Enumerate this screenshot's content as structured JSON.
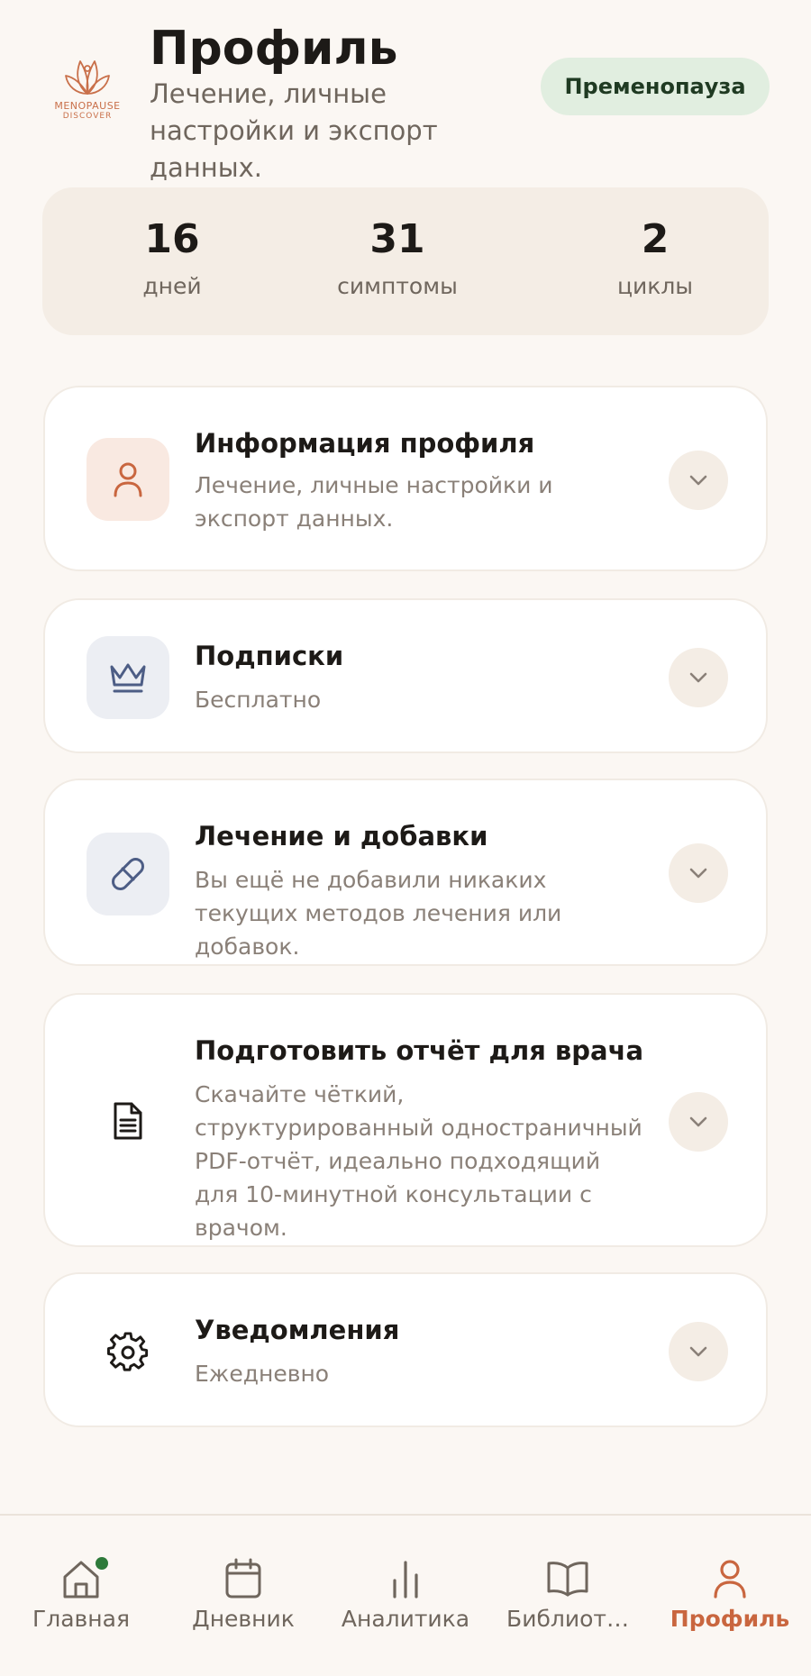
{
  "header": {
    "logo_brand": "MENOPAUSE",
    "logo_sub": "DISCOVER",
    "title": "Профиль",
    "subtitle": "Лечение, личные настройки и экспорт данных.",
    "stage_badge": "Пременопауза"
  },
  "stats": [
    {
      "value": "16",
      "label": "дней"
    },
    {
      "value": "31",
      "label": "симптомы"
    },
    {
      "value": "2",
      "label": "циклы"
    }
  ],
  "cards": [
    {
      "title": "Информация профиля",
      "subtitle": "Лечение, личные настройки и экспорт данных.",
      "icon": "person-icon"
    },
    {
      "title": "Подписки",
      "subtitle": "Бесплатно",
      "icon": "crown-icon"
    },
    {
      "title": "Лечение и добавки",
      "subtitle": "Вы ещё не добавили никаких текущих методов лечения или добавок.",
      "icon": "pill-icon"
    },
    {
      "title": "Подготовить отчёт для врача",
      "subtitle": "Скачайте чёткий, структурированный одностраничный PDF-отчёт, идеально подходящий для 10-минутной консультации с врачом.",
      "icon": "document-icon"
    },
    {
      "title": "Уведомления",
      "subtitle": "Ежедневно",
      "icon": "gear-icon"
    }
  ],
  "nav": [
    {
      "label": "Главная",
      "icon": "home-icon"
    },
    {
      "label": "Дневник",
      "icon": "calendar-icon"
    },
    {
      "label": "Аналитика",
      "icon": "chart-icon"
    },
    {
      "label": "Библиот…",
      "icon": "book-icon"
    },
    {
      "label": "Профиль",
      "icon": "person-icon"
    }
  ],
  "colors": {
    "background": "#fbf7f3",
    "accent": "#c9663f",
    "badge_bg": "#e1eee0",
    "stats_bg": "#f4ede5"
  }
}
